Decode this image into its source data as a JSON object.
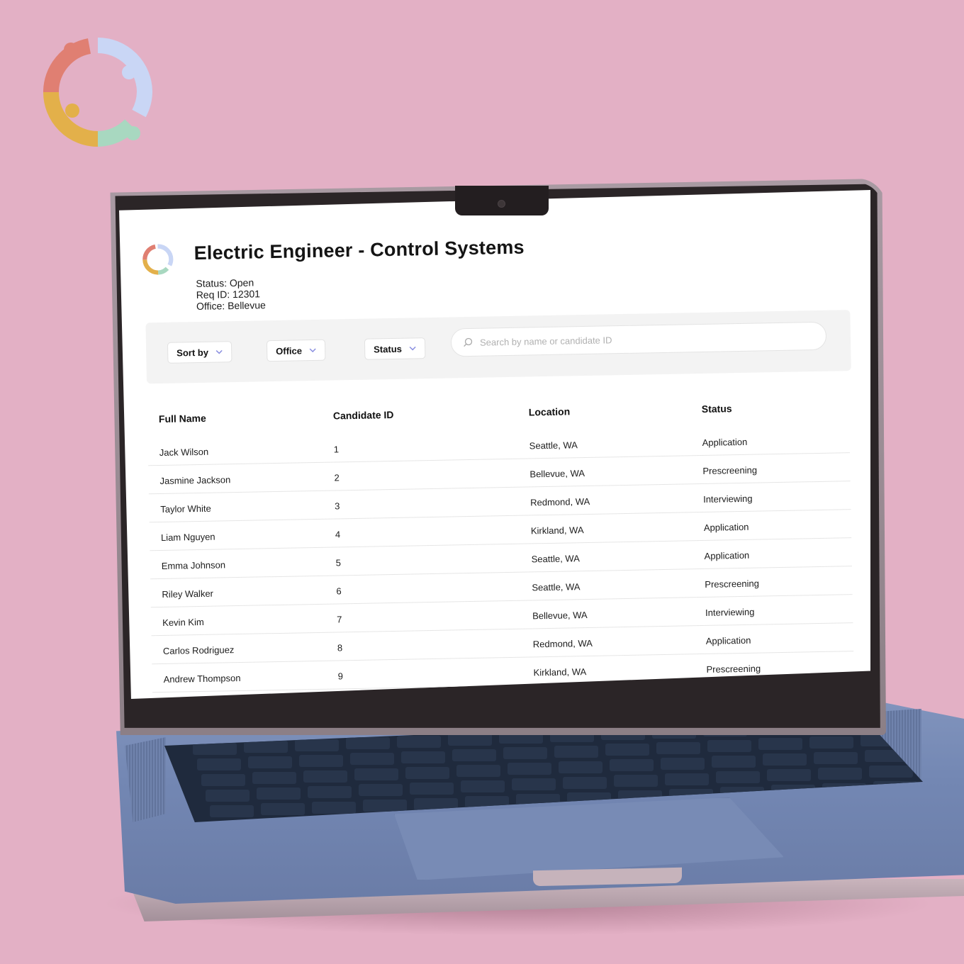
{
  "job": {
    "title": "Electric Engineer -  Control Systems",
    "status": "Status: Open",
    "req_id": "Req ID: 12301",
    "office": "Office: Bellevue"
  },
  "filters": {
    "sort_label": "Sort by",
    "office_label": "Office",
    "status_label": "Status",
    "search_placeholder": "Search by name or candidate ID"
  },
  "table": {
    "headers": [
      "Full Name",
      "Candidate ID",
      "Location",
      "Status"
    ],
    "rows": [
      {
        "name": "Jack Wilson",
        "id": "1",
        "location": "Seattle, WA",
        "status": "Application"
      },
      {
        "name": "Jasmine Jackson",
        "id": "2",
        "location": "Bellevue, WA",
        "status": "Prescreening"
      },
      {
        "name": "Taylor White",
        "id": "3",
        "location": "Redmond, WA",
        "status": "Interviewing"
      },
      {
        "name": "Liam Nguyen",
        "id": "4",
        "location": "Kirkland, WA",
        "status": "Application"
      },
      {
        "name": "Emma Johnson",
        "id": "5",
        "location": "Seattle, WA",
        "status": "Application"
      },
      {
        "name": "Riley Walker",
        "id": "6",
        "location": "Seattle, WA",
        "status": "Prescreening"
      },
      {
        "name": "Kevin Kim",
        "id": "7",
        "location": "Bellevue, WA",
        "status": "Interviewing"
      },
      {
        "name": "Carlos Rodriguez",
        "id": "8",
        "location": "Redmond, WA",
        "status": "Application"
      },
      {
        "name": "Andrew Thompson",
        "id": "9",
        "location": "Kirkland, WA",
        "status": "Prescreening"
      }
    ]
  },
  "colors": {
    "background": "#e3b0c5",
    "logo_red": "#e07f72",
    "logo_blue": "#c9d6f5",
    "logo_green": "#a8d8c0",
    "logo_yellow": "#e3b04a",
    "laptop_body": "#7387b3"
  },
  "icons": [
    "brand-logo-icon",
    "chevron-down-icon",
    "search-icon"
  ]
}
